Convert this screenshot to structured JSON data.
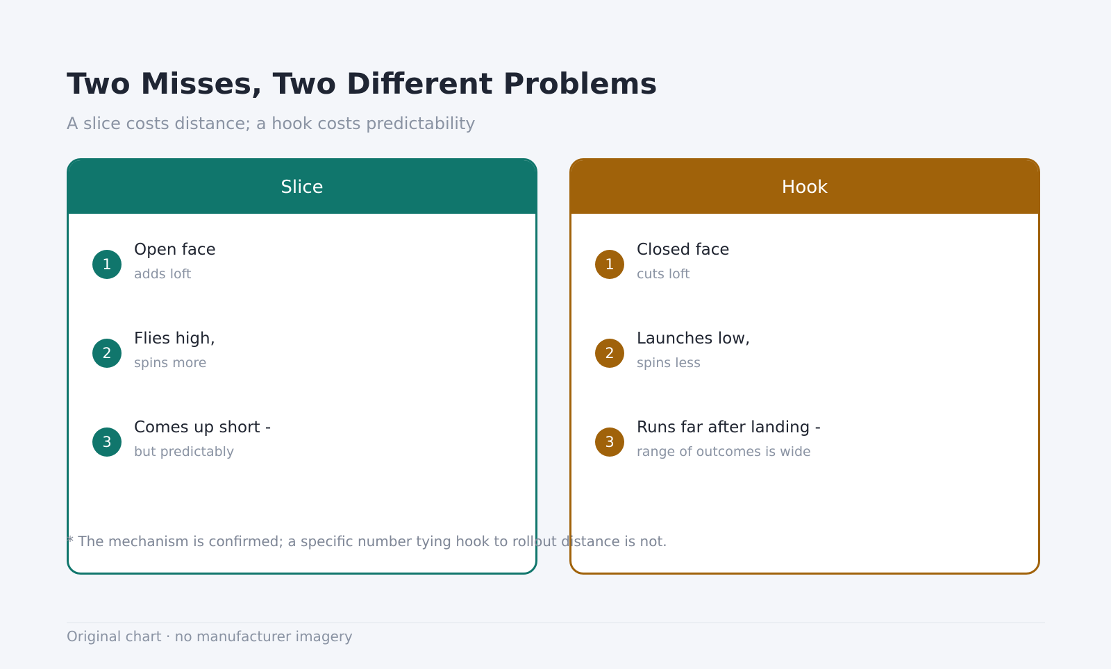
{
  "title": "Two Misses, Two Different Problems",
  "subtitle": "A slice costs distance; a hook costs predictability",
  "colors": {
    "slice": "#10766c",
    "hook": "#a0620a",
    "background": "#f4f6fa"
  },
  "panels": [
    {
      "label": "Slice",
      "items": [
        {
          "num": "1",
          "main": "Open face",
          "sub": "adds loft"
        },
        {
          "num": "2",
          "main": "Flies high,",
          "sub": "spins more"
        },
        {
          "num": "3",
          "main": "Comes up short -",
          "sub": "but predictably"
        }
      ]
    },
    {
      "label": "Hook",
      "items": [
        {
          "num": "1",
          "main": "Closed face",
          "sub": "cuts loft"
        },
        {
          "num": "2",
          "main": "Launches low,",
          "sub": "spins less"
        },
        {
          "num": "3",
          "main": "Runs far after landing -",
          "sub": "range of outcomes is wide"
        }
      ]
    }
  ],
  "footnote": "* The mechanism is confirmed; a specific number tying hook to rollout distance is not.",
  "source": "Original chart · no manufacturer imagery"
}
